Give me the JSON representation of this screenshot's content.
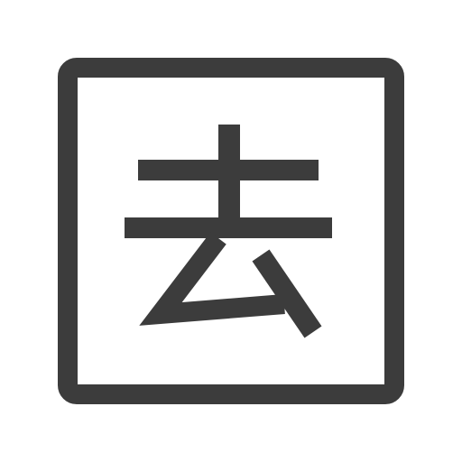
{
  "icon": {
    "name": "kanji-qu-squared-icon",
    "glyph": "去",
    "color": "#3c3c3c",
    "background": "#ffffff"
  }
}
